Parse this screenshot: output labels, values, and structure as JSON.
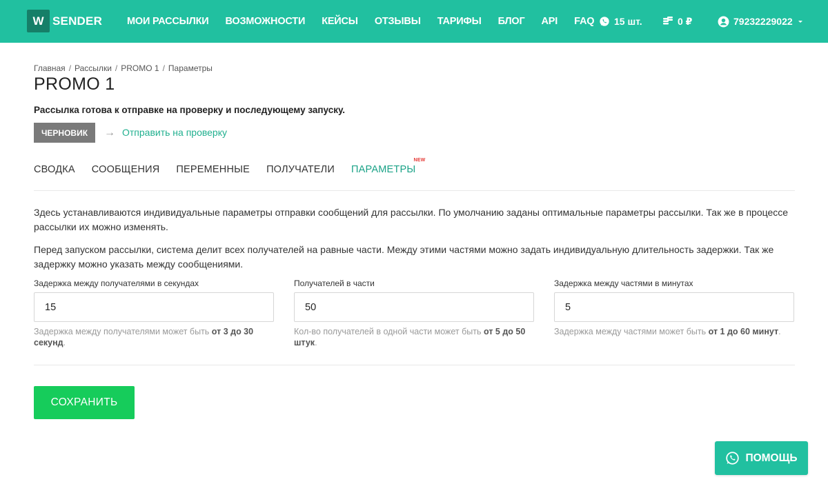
{
  "header": {
    "logo_letter": "W",
    "logo_text": "SENDER",
    "nav": [
      "МОИ РАССЫЛКИ",
      "ВОЗМОЖНОСТИ",
      "КЕЙСЫ",
      "ОТЗЫВЫ",
      "ТАРИФЫ",
      "БЛОГ",
      "API",
      "FAQ"
    ],
    "whatsapp_count": "15 шт.",
    "balance": "0 ₽",
    "account": "79232229022"
  },
  "breadcrumb": [
    "Главная",
    "Рассылки",
    "PROMO 1",
    "Параметры"
  ],
  "page_title": "PROMO 1",
  "ready_message": "Рассылка готова к отправке на проверку и последующему запуску.",
  "status_badge": "ЧЕРНОВИК",
  "send_link": "Отправить на проверку",
  "tabs": [
    "СВОДКА",
    "СООБЩЕНИЯ",
    "ПЕРЕМЕННЫЕ",
    "ПОЛУЧАТЕЛИ",
    "ПАРАМЕТРЫ"
  ],
  "active_tab": "ПАРАМЕТРЫ",
  "new_badge": "NEW",
  "paragraphs": [
    "Здесь устанавливаются индивидуальные параметры отправки сообщений для рассылки. По умолчанию заданы оптимальные параметры рассылки. Так же в процессе рассылки их можно изменять.",
    "Перед запуском рассылки, система делит всех получателей на равные части. Между этими частями можно задать индивидуальную длительность задержки. Так же задержку можно указать между сообщениями."
  ],
  "fields": [
    {
      "label": "Задержка между получателями в секундах",
      "value": "15",
      "help_prefix": "Задержка между получателями может быть ",
      "help_bold": "от 3 до 30 секунд",
      "help_suffix": "."
    },
    {
      "label": "Получателей в части",
      "value": "50",
      "help_prefix": "Кол-во получателей в одной части может быть ",
      "help_bold": "от 5 до 50 штук",
      "help_suffix": "."
    },
    {
      "label": "Задержка между частями в минутах",
      "value": "5",
      "help_prefix": "Задержка между частями может быть ",
      "help_bold": "от 1 до 60 минут",
      "help_suffix": "."
    }
  ],
  "save_button": "СОХРАНИТЬ",
  "help_button": "ПОМОЩЬ",
  "colors": {
    "brand": "#21c0a0",
    "brand_dark": "#167f68",
    "save": "#16cc5b",
    "active_tab": "#1aa287",
    "badge": "#7a7a7a"
  },
  "icons": [
    "whatsapp-icon",
    "coins-icon",
    "user-icon",
    "chevron-down-icon",
    "arrow-right-icon"
  ]
}
